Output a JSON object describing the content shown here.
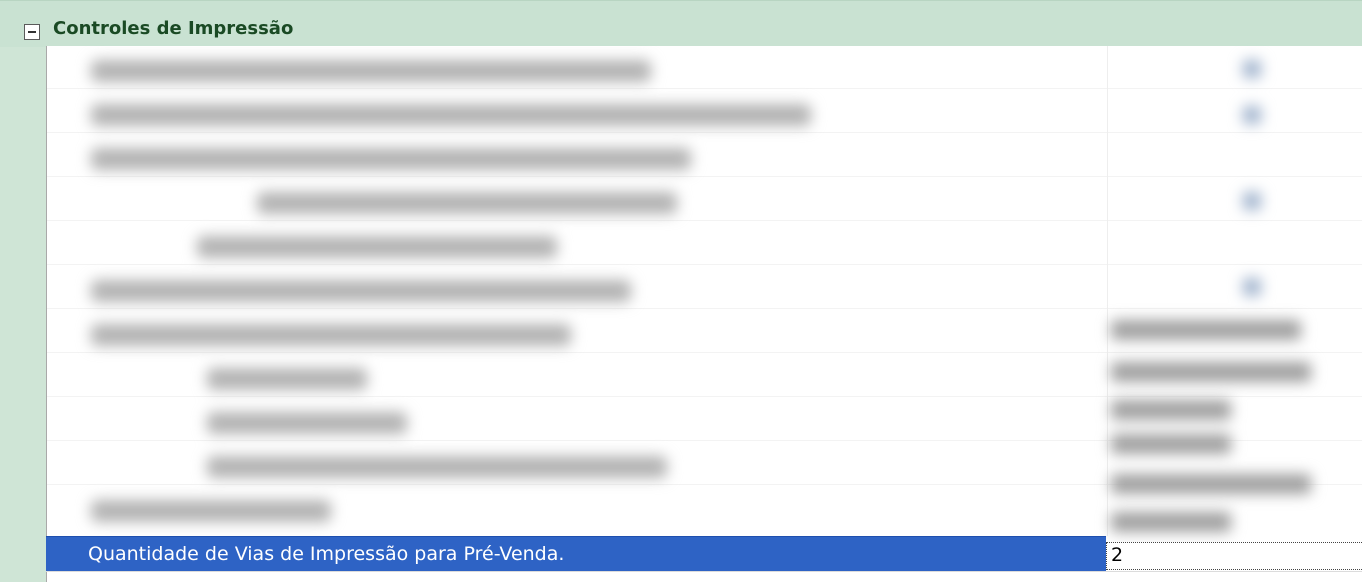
{
  "section": {
    "title": "Controles de Impressão",
    "collapse_icon": "minus-box-icon"
  },
  "selected_setting": {
    "label": "Quantidade de Vias de Impressão para Pré-Venda.",
    "value": "2"
  },
  "colors": {
    "header_bg": "#c9e2d2",
    "title_text": "#1a4a24",
    "selection_bg": "#2e63c5",
    "selection_text": "#ffffff"
  }
}
